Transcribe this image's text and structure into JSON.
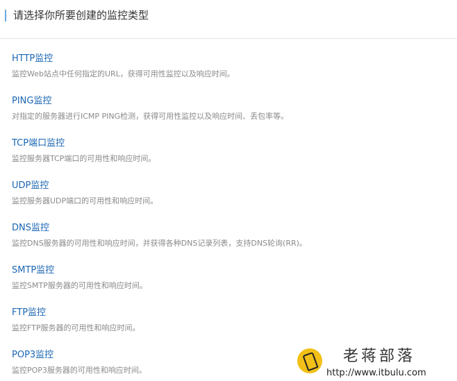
{
  "header": {
    "title": "请选择你所要创建的监控类型"
  },
  "monitor_types": [
    {
      "title": "HTTP监控",
      "desc": "监控Web站点中任何指定的URL，获得可用性监控以及响应时间。"
    },
    {
      "title": "PING监控",
      "desc": "对指定的服务器进行ICMP PING检测，获得可用性监控以及响应时间、丢包率等。"
    },
    {
      "title": "TCP端口监控",
      "desc": "监控服务器TCP端口的可用性和响应时间。"
    },
    {
      "title": "UDP监控",
      "desc": "监控服务器UDP端口的可用性和响应时间。"
    },
    {
      "title": "DNS监控",
      "desc": "监控DNS服务器的可用性和响应时间，并获得各种DNS记录列表，支持DNS轮询(RR)。"
    },
    {
      "title": "SMTP监控",
      "desc": "监控SMTP服务器的可用性和响应时间。"
    },
    {
      "title": "FTP监控",
      "desc": "监控FTP服务器的可用性和响应时间。"
    },
    {
      "title": "POP3监控",
      "desc": "监控POP3服务器的可用性和响应时间。"
    }
  ],
  "watermark": {
    "name": "老蒋部落",
    "url": "http://www.itbulu.com"
  },
  "colors": {
    "link": "#1a66b3",
    "desc": "#8a8a8a",
    "accent_bar": "#6aa7df",
    "logo": "#f2c018"
  }
}
